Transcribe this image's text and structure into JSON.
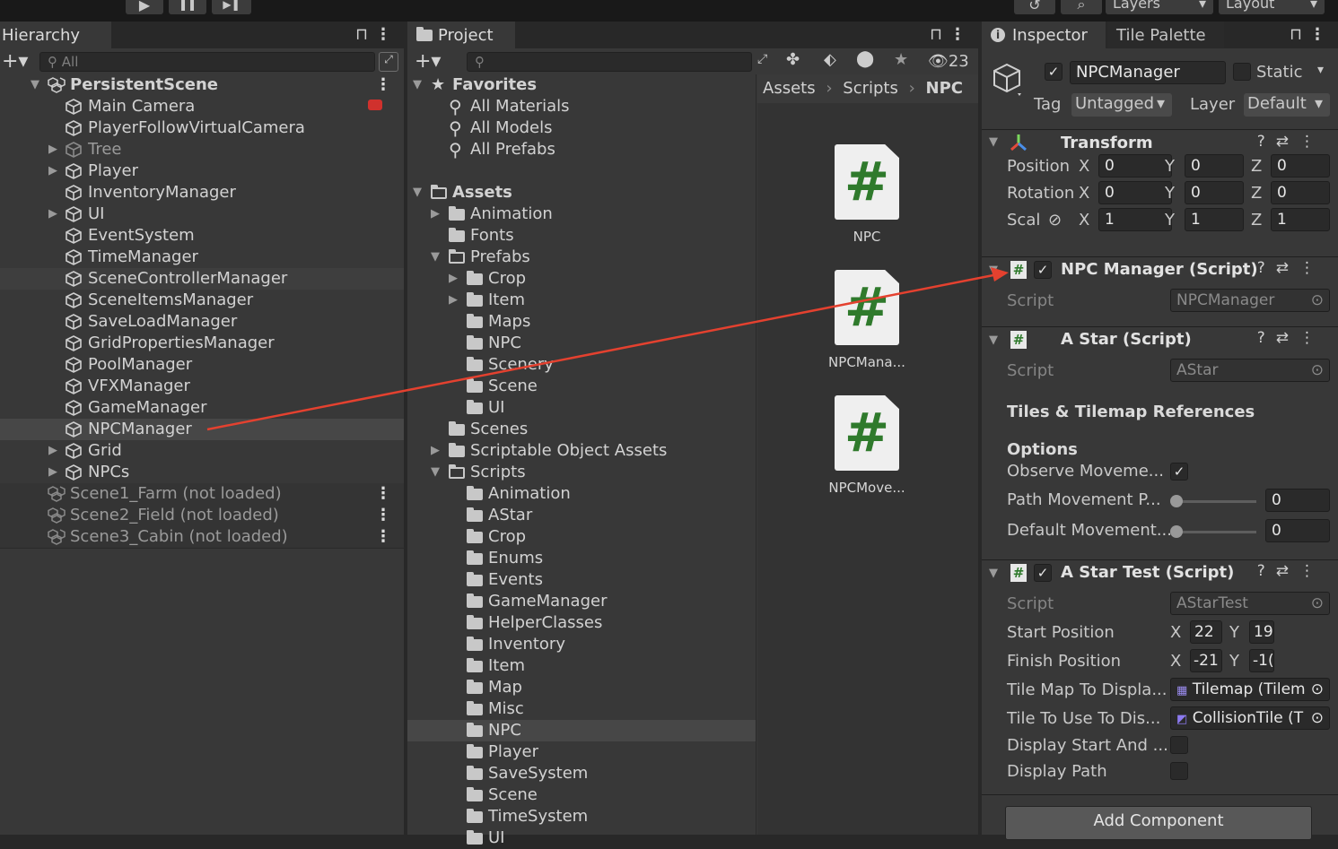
{
  "topbar": {
    "play": "▶",
    "pause": "❚❚",
    "step": "▶❚",
    "history_icon": "↺",
    "search_icon": "⌕",
    "layers": "Layers",
    "layout": "Layout"
  },
  "hierarchy": {
    "tab": "Hierarchy",
    "add": "+",
    "search_placeholder": "All",
    "lock": "🔒",
    "rows": [
      {
        "label": "PersistentScene",
        "indent": 0,
        "expand": "open",
        "icon": "scene",
        "bold": true,
        "menu": true
      },
      {
        "label": "Main Camera",
        "indent": 1,
        "icon": "cube"
      },
      {
        "label": "PlayerFollowVirtualCamera",
        "indent": 1,
        "icon": "cube"
      },
      {
        "label": "Tree",
        "indent": 1,
        "expand": "closed",
        "icon": "cube",
        "dim": true
      },
      {
        "label": "Player",
        "indent": 1,
        "expand": "closed",
        "icon": "cube"
      },
      {
        "label": "InventoryManager",
        "indent": 1,
        "icon": "cube"
      },
      {
        "label": "UI",
        "indent": 1,
        "expand": "closed",
        "icon": "cube"
      },
      {
        "label": "EventSystem",
        "indent": 1,
        "icon": "cube"
      },
      {
        "label": "TimeManager",
        "indent": 1,
        "icon": "cube"
      },
      {
        "label": "SceneControllerManager",
        "indent": 1,
        "icon": "cube",
        "hover": true
      },
      {
        "label": "SceneItemsManager",
        "indent": 1,
        "icon": "cube"
      },
      {
        "label": "SaveLoadManager",
        "indent": 1,
        "icon": "cube"
      },
      {
        "label": "GridPropertiesManager",
        "indent": 1,
        "icon": "cube"
      },
      {
        "label": "PoolManager",
        "indent": 1,
        "icon": "cube"
      },
      {
        "label": "VFXManager",
        "indent": 1,
        "icon": "cube"
      },
      {
        "label": "GameManager",
        "indent": 1,
        "icon": "cube"
      },
      {
        "label": "NPCManager",
        "indent": 1,
        "icon": "cube",
        "selected": true
      },
      {
        "label": "Grid",
        "indent": 1,
        "expand": "closed",
        "icon": "cube"
      },
      {
        "label": "NPCs",
        "indent": 1,
        "expand": "closed",
        "icon": "cube"
      },
      {
        "label": "Scene1_Farm (not loaded)",
        "indent": 0,
        "icon": "scene",
        "dim": true,
        "menu": true,
        "unloaded": true
      },
      {
        "label": "Scene2_Field (not loaded)",
        "indent": 0,
        "icon": "scene",
        "dim": true,
        "menu": true,
        "unloaded": true
      },
      {
        "label": "Scene3_Cabin (not loaded)",
        "indent": 0,
        "icon": "scene",
        "dim": true,
        "menu": true,
        "unloaded": true
      }
    ]
  },
  "project": {
    "tab": "Project",
    "add": "+",
    "hidden_count": "23",
    "breadcrumb": [
      "Assets",
      "Scripts",
      "NPC"
    ],
    "tree": [
      {
        "label": "Favorites",
        "indent": 0,
        "expand": "open",
        "icon": "star",
        "bold": true
      },
      {
        "label": "All Materials",
        "indent": 1,
        "icon": "search"
      },
      {
        "label": "All Models",
        "indent": 1,
        "icon": "search"
      },
      {
        "label": "All Prefabs",
        "indent": 1,
        "icon": "search"
      },
      {
        "label": "",
        "indent": 0,
        "icon": "none"
      },
      {
        "label": "Assets",
        "indent": 0,
        "expand": "open",
        "icon": "folder-open",
        "bold": true
      },
      {
        "label": "Animation",
        "indent": 1,
        "expand": "closed",
        "icon": "folder"
      },
      {
        "label": "Fonts",
        "indent": 1,
        "icon": "folder"
      },
      {
        "label": "Prefabs",
        "indent": 1,
        "expand": "open",
        "icon": "folder-open"
      },
      {
        "label": "Crop",
        "indent": 2,
        "expand": "closed",
        "icon": "folder"
      },
      {
        "label": "Item",
        "indent": 2,
        "expand": "closed",
        "icon": "folder"
      },
      {
        "label": "Maps",
        "indent": 2,
        "icon": "folder"
      },
      {
        "label": "NPC",
        "indent": 2,
        "icon": "folder"
      },
      {
        "label": "Scenery",
        "indent": 2,
        "icon": "folder"
      },
      {
        "label": "Scene",
        "indent": 2,
        "icon": "folder"
      },
      {
        "label": "UI",
        "indent": 2,
        "icon": "folder"
      },
      {
        "label": "Scenes",
        "indent": 1,
        "icon": "folder"
      },
      {
        "label": "Scriptable Object Assets",
        "indent": 1,
        "expand": "closed",
        "icon": "folder"
      },
      {
        "label": "Scripts",
        "indent": 1,
        "expand": "open",
        "icon": "folder-open"
      },
      {
        "label": "Animation",
        "indent": 2,
        "icon": "folder"
      },
      {
        "label": "AStar",
        "indent": 2,
        "icon": "folder"
      },
      {
        "label": "Crop",
        "indent": 2,
        "icon": "folder"
      },
      {
        "label": "Enums",
        "indent": 2,
        "icon": "folder"
      },
      {
        "label": "Events",
        "indent": 2,
        "icon": "folder"
      },
      {
        "label": "GameManager",
        "indent": 2,
        "icon": "folder"
      },
      {
        "label": "HelperClasses",
        "indent": 2,
        "icon": "folder"
      },
      {
        "label": "Inventory",
        "indent": 2,
        "icon": "folder"
      },
      {
        "label": "Item",
        "indent": 2,
        "icon": "folder"
      },
      {
        "label": "Map",
        "indent": 2,
        "icon": "folder"
      },
      {
        "label": "Misc",
        "indent": 2,
        "icon": "folder"
      },
      {
        "label": "NPC",
        "indent": 2,
        "icon": "folder",
        "selected": true
      },
      {
        "label": "Player",
        "indent": 2,
        "icon": "folder"
      },
      {
        "label": "SaveSystem",
        "indent": 2,
        "icon": "folder"
      },
      {
        "label": "Scene",
        "indent": 2,
        "icon": "folder"
      },
      {
        "label": "TimeSystem",
        "indent": 2,
        "icon": "folder"
      },
      {
        "label": "UI",
        "indent": 2,
        "icon": "folder"
      }
    ],
    "files": [
      {
        "name": "NPC",
        "glyph": "#"
      },
      {
        "name": "NPCMana...",
        "glyph": "#"
      },
      {
        "name": "NPCMove...",
        "glyph": "#"
      }
    ]
  },
  "inspector": {
    "tab": "Inspector",
    "tab2": "Tile Palette",
    "info_icon": "i",
    "object": {
      "name": "NPCManager",
      "active": "✓",
      "static_label": "Static",
      "tag_label": "Tag",
      "tag": "Untagged",
      "layer_label": "Layer",
      "layer": "Default"
    },
    "transform": {
      "title": "Transform",
      "rows": [
        {
          "label": "Position",
          "x": "0",
          "y": "0",
          "z": "0"
        },
        {
          "label": "Rotation",
          "x": "0",
          "y": "0",
          "z": "0"
        },
        {
          "label": "Scale",
          "x": "1",
          "y": "1",
          "z": "1"
        }
      ],
      "axis": {
        "x": "X",
        "y": "Y",
        "z": "Z"
      }
    },
    "npc_manager": {
      "title": "NPC Manager (Script)",
      "enabled": "✓",
      "script_label": "Script",
      "script": "NPCManager"
    },
    "astar": {
      "title": "A Star (Script)",
      "script_label": "Script",
      "script": "AStar",
      "section1": "Tiles & Tilemap References",
      "section2": "Options",
      "observe_label": "Observe Moveme...",
      "observe": "✓",
      "path_label": "Path Movement P...",
      "path_value": "0",
      "default_label": "Default Movement...",
      "default_value": "0"
    },
    "astar_test": {
      "title": "A Star Test (Script)",
      "enabled": "✓",
      "script_label": "Script",
      "script": "AStarTest",
      "start_label": "Start Position",
      "start_x": "22",
      "start_y": "19",
      "finish_label": "Finish Position",
      "finish_x": "-21",
      "finish_y": "-1(",
      "tilemap_label": "Tile Map To Displa...",
      "tilemap": "Tilemap (Tilem",
      "tile_label": "Tile To Use To Dis...",
      "tile": "CollisionTile (T",
      "display_start_label": "Display Start And ...",
      "display_path_label": "Display Path"
    },
    "add_component": "Add Component"
  },
  "colors": {
    "accent_red": "#e4412f",
    "selection": "#474747",
    "script_green": "#2f7a2c"
  }
}
